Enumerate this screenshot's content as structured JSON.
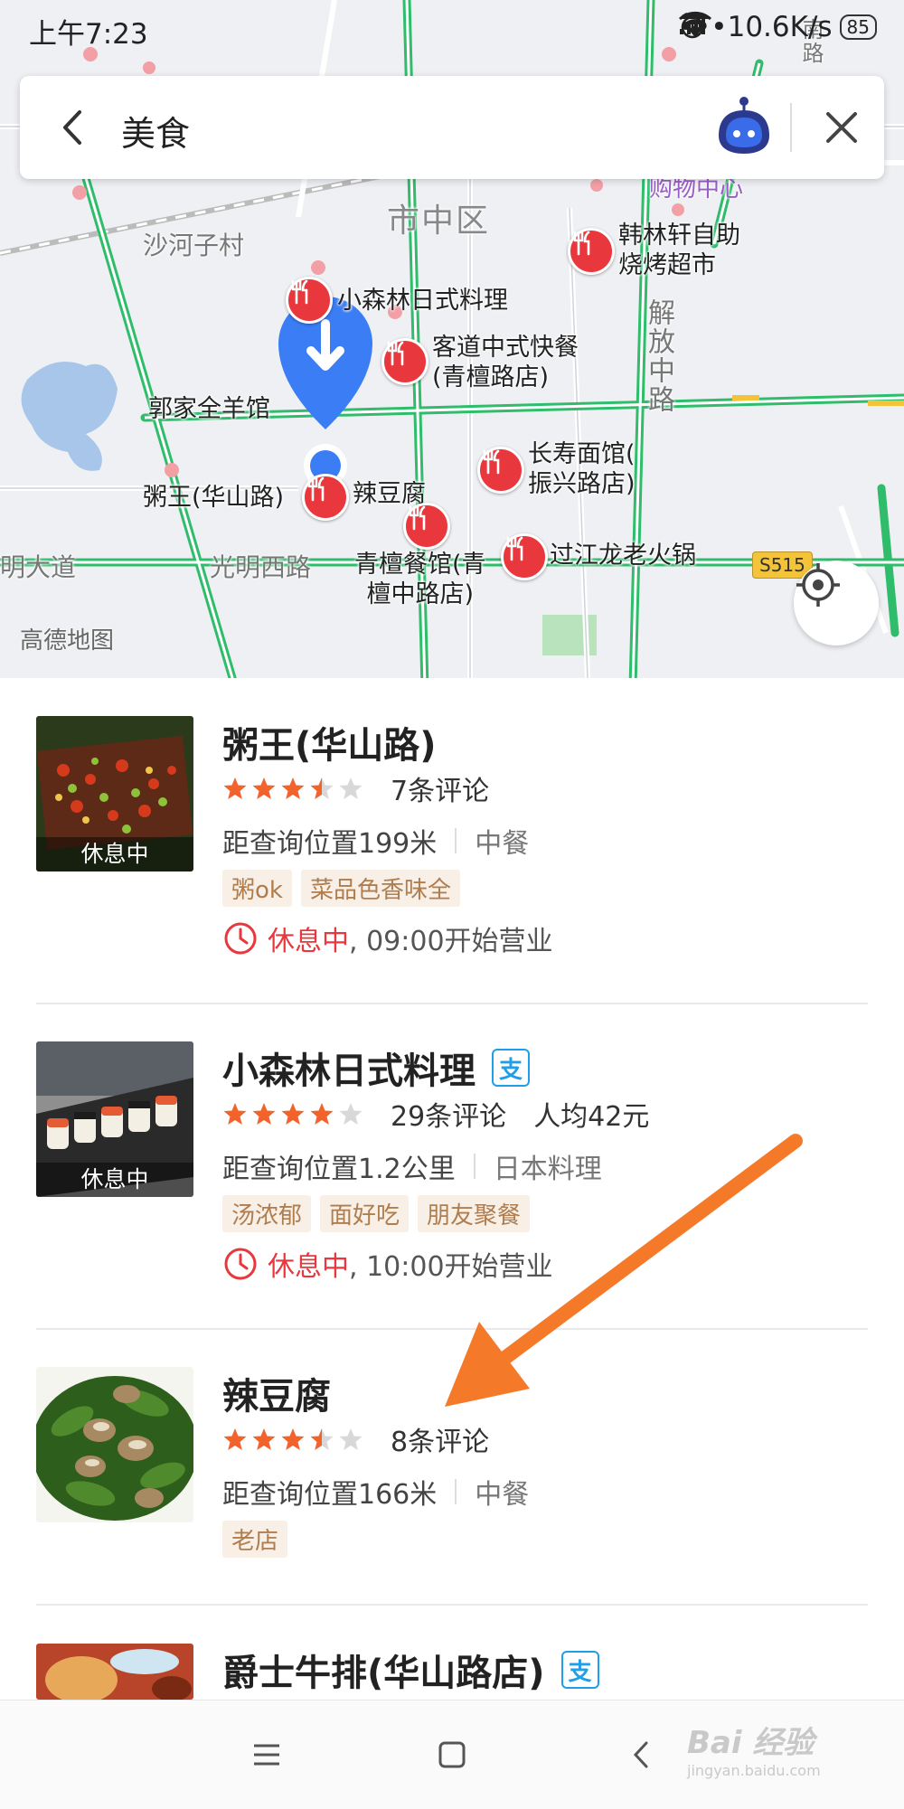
{
  "status_bar": {
    "time": "上午7:23",
    "net_speed": "•••10.6K/s",
    "battery": "85"
  },
  "search": {
    "query": "美食"
  },
  "map": {
    "district": "市中区",
    "village": "沙河子村",
    "road_guangming": "光明西路",
    "road_dadao": "明大道",
    "road_jiefang": "解放中路",
    "road_vertical_top": "南路",
    "mall": "购物中心",
    "road_badge": "S515",
    "logo": "高德地图",
    "pois": [
      {
        "name": "韩林轩自助\n烧烤超市"
      },
      {
        "name": "小森林日式料理"
      },
      {
        "name": "客道中式快餐\n(青檀路店)"
      },
      {
        "name": "郭家全羊馆"
      },
      {
        "name": "长寿面馆(\n振兴路店)"
      },
      {
        "name": "粥王(华山路)"
      },
      {
        "name": "辣豆腐"
      },
      {
        "name": "青檀餐馆(青\n檀中路店)"
      },
      {
        "name": "过江龙老火锅"
      }
    ]
  },
  "list": [
    {
      "name": "粥王(华山路)",
      "rating": 3.5,
      "reviews": "7条评论",
      "avg": "",
      "distance": "距查询位置199米",
      "category": "中餐",
      "tags": [
        "粥ok",
        "菜品色香味全"
      ],
      "status": "休息中",
      "open": ", 09:00开始营业",
      "thumb_badge": "休息中",
      "alipay": false,
      "alipay_label": ""
    },
    {
      "name": "小森林日式料理",
      "rating": 4,
      "reviews": "29条评论",
      "avg": "人均42元",
      "distance": "距查询位置1.2公里",
      "category": "日本料理",
      "tags": [
        "汤浓郁",
        "面好吃",
        "朋友聚餐"
      ],
      "status": "休息中",
      "open": ", 10:00开始营业",
      "thumb_badge": "休息中",
      "alipay": true,
      "alipay_label": "支"
    },
    {
      "name": "辣豆腐",
      "rating": 3.5,
      "reviews": "8条评论",
      "avg": "",
      "distance": "距查询位置166米",
      "category": "中餐",
      "tags": [
        "老店"
      ],
      "status": "",
      "open": "",
      "thumb_badge": "",
      "alipay": false,
      "alipay_label": ""
    },
    {
      "name": "爵士牛排(华山路店)",
      "alipay": true,
      "alipay_label": "支"
    }
  ],
  "watermark": {
    "brand": "Bai 经验",
    "url": "jingyan.baidu.com"
  },
  "colors": {
    "accent": "#e8383d",
    "star": "#f2622b",
    "star_empty": "#d8d8d8",
    "road": "#2fbd6b",
    "pin_blue": "#3b7df4",
    "arrow": "#f47a2a"
  }
}
